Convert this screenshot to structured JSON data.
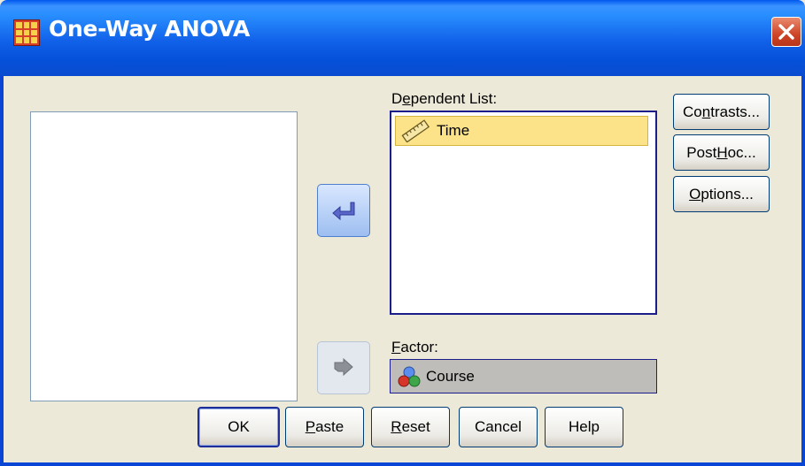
{
  "window": {
    "title": "One-Way ANOVA"
  },
  "dependent_list": {
    "label_pre": "D",
    "label_mnemonic": "e",
    "label_post": "pendent List:",
    "items": [
      {
        "icon": "ruler-icon",
        "label": "Time"
      }
    ]
  },
  "factor": {
    "label_mnemonic": "F",
    "label_post": "actor:",
    "item": {
      "icon": "nominal-variable-icon",
      "label": "Course"
    }
  },
  "side_buttons": {
    "contrasts": {
      "pre": "Co",
      "mnemonic": "n",
      "post": "trasts..."
    },
    "post_hoc": {
      "pre": "Post ",
      "mnemonic": "H",
      "post": "oc..."
    },
    "options": {
      "pre": "",
      "mnemonic": "O",
      "post": "ptions..."
    }
  },
  "bottom_buttons": {
    "ok": "OK",
    "paste": {
      "mnemonic": "P",
      "post": "aste"
    },
    "reset": {
      "mnemonic": "R",
      "post": "eset"
    },
    "cancel": "Cancel",
    "help": "Help"
  },
  "colors": {
    "title_bar": "#0A4CD0",
    "dialog_bg": "#ECE9D8",
    "selected_item": "#FCE38A",
    "factor_bg": "#BEBDB9"
  }
}
